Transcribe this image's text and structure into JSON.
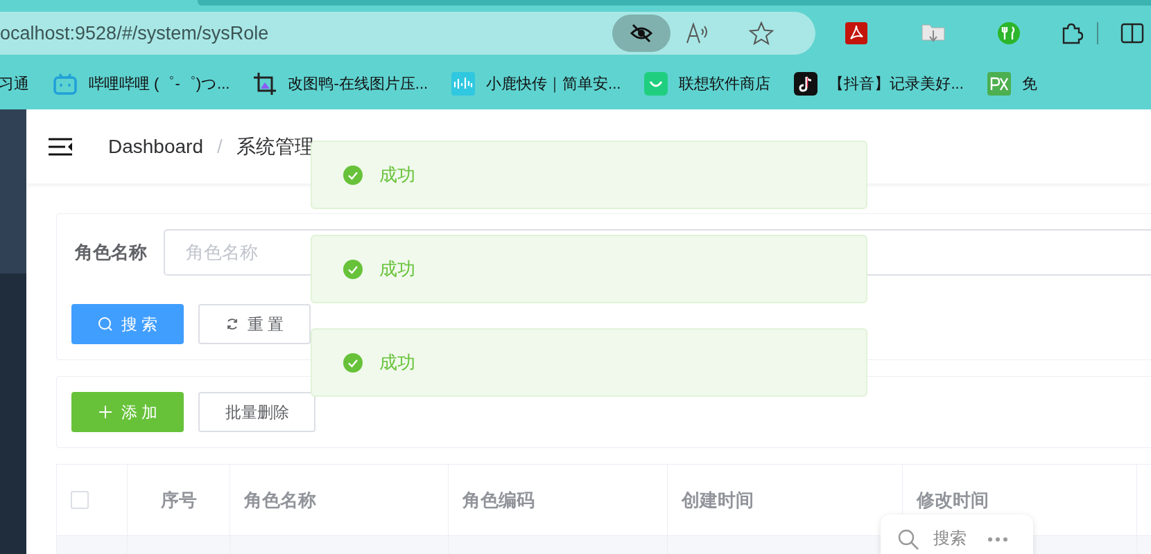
{
  "browser": {
    "url": "ocalhost:9528/#/system/sysRole"
  },
  "bookmarks": [
    {
      "label": "习通",
      "kind": "none"
    },
    {
      "label": "哔哩哔哩 (゜-゜)つ...",
      "kind": "tv"
    },
    {
      "label": "改图鸭-在线图片压...",
      "kind": "crop"
    },
    {
      "label": "小鹿快传｜简单安...",
      "kind": "wave"
    },
    {
      "label": "联想软件商店",
      "kind": "bag"
    },
    {
      "label": "【抖音】记录美好...",
      "kind": "note"
    },
    {
      "label": "免",
      "kind": "px"
    }
  ],
  "breadcrumb": {
    "separator": "/",
    "items": [
      "Dashboard",
      "系统管理"
    ]
  },
  "search_form": {
    "label": "角色名称",
    "placeholder": "角色名称",
    "buttons": [
      {
        "label": "搜 索",
        "kind": "primary"
      },
      {
        "label": "重 置",
        "kind": "reset"
      }
    ]
  },
  "toolbar": {
    "buttons": [
      {
        "label": "添 加",
        "kind": "success"
      },
      {
        "label": "批量删除",
        "kind": "plain"
      }
    ]
  },
  "table": {
    "select_all": {
      "checked": false
    },
    "columns": [
      "序号",
      "角色名称",
      "角色编码",
      "创建时间",
      "修改时间"
    ]
  },
  "toasts": [
    {
      "message": "成功",
      "kind": "success"
    },
    {
      "message": "成功",
      "kind": "success"
    },
    {
      "message": "成功",
      "kind": "success"
    }
  ],
  "selection_popup": {
    "label": "搜索"
  }
}
